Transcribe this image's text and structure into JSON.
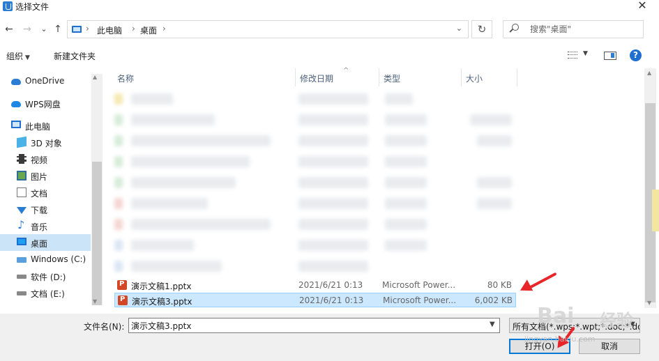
{
  "window": {
    "title": "选择文件",
    "close": "✕"
  },
  "nav": {
    "back": "←",
    "forward": "→",
    "recent": "⌄",
    "up": "↑",
    "breadcrumbs": [
      "此电脑",
      "桌面"
    ],
    "refresh": "↻",
    "search_placeholder": "搜索\"桌面\""
  },
  "toolbar": {
    "organize": "组织",
    "new_folder": "新建文件夹",
    "help": "?"
  },
  "sidebar": {
    "items": [
      {
        "label": "OneDrive",
        "icon": "cloud-icon"
      },
      {
        "label": "WPS网盘",
        "icon": "cloud-icon"
      },
      {
        "label": "此电脑",
        "icon": "computer-icon"
      },
      {
        "label": "3D 对象",
        "icon": "cube-icon"
      },
      {
        "label": "视频",
        "icon": "video-icon"
      },
      {
        "label": "图片",
        "icon": "image-icon"
      },
      {
        "label": "文档",
        "icon": "document-icon"
      },
      {
        "label": "下载",
        "icon": "download-icon"
      },
      {
        "label": "音乐",
        "icon": "music-icon"
      },
      {
        "label": "桌面",
        "icon": "desktop-icon"
      },
      {
        "label": "Windows (C:)",
        "icon": "drive-icon"
      },
      {
        "label": "软件 (D:)",
        "icon": "drive-icon"
      },
      {
        "label": "文档 (E:)",
        "icon": "drive-icon"
      }
    ]
  },
  "columns": {
    "name": "名称",
    "date": "修改日期",
    "type": "类型",
    "size": "大小"
  },
  "files": [
    {
      "name": "演示文稿1.pptx",
      "date": "2021/6/21 0:13",
      "type": "Microsoft Power...",
      "size": "80 KB"
    },
    {
      "name": "演示文稿3.pptx",
      "date": "2021/6/21 0:13",
      "type": "Microsoft Power...",
      "size": "6,002 KB"
    }
  ],
  "bottom": {
    "filename_label": "文件名(N):",
    "filename_value": "演示文稿3.pptx",
    "filter_text": "所有文档(*.wps;*.wpt;*.doc;*.dot;*.docx",
    "open_button": "打开(O)",
    "cancel_button": "取消"
  },
  "watermark": {
    "brand": "Bai",
    "brand2": "经验",
    "url": "jingyan.baidu.com"
  },
  "colors": {
    "accent": "#0078d7",
    "selection": "#cce8ff",
    "annotation": "#e8262a"
  }
}
